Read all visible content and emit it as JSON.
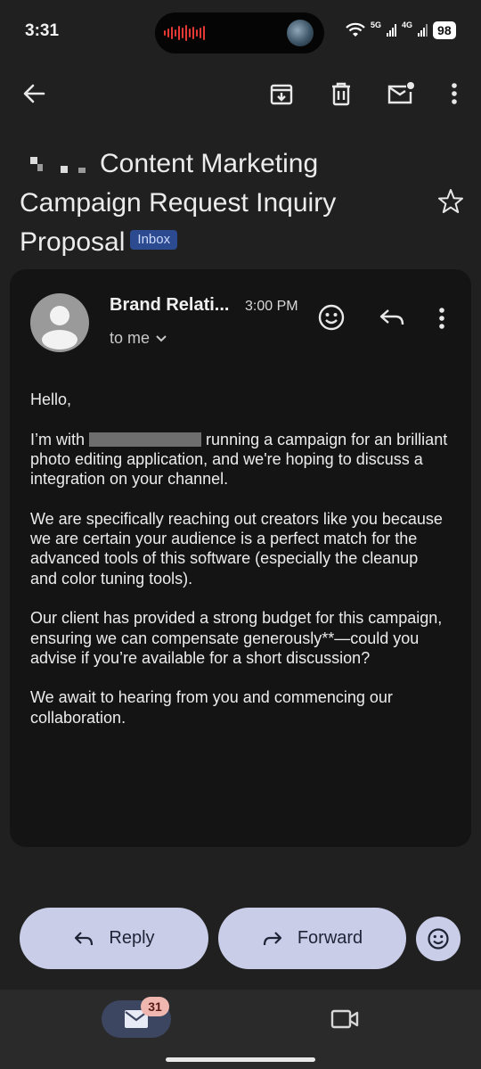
{
  "status_bar": {
    "time": "3:31",
    "net_a": "5G",
    "net_b": "4G",
    "battery": "98"
  },
  "toolbar": {
    "back": "arrow-left-icon",
    "archive": "archive-icon",
    "delete": "trash-icon",
    "mark_unread": "mark-unread-icon",
    "more": "more-vert-icon"
  },
  "subject": {
    "text": "Content Marketing Campaign Request Inquiry Proposal",
    "label": "Inbox"
  },
  "email": {
    "sender": "Brand Relati...",
    "time": "3:00 PM",
    "recipient": "to me",
    "greeting": "Hello,",
    "p1_before": "I’m with",
    "p1_after": "running a campaign for an brilliant photo editing application, and we're hoping to discuss a integration on your channel.",
    "p2": "We are specifically reaching out creators like you because we are certain your audience is a perfect match for the advanced tools of this software (especially the cleanup and color tuning tools).",
    "p3": "Our client has provided a strong budget for this campaign, ensuring we can compensate generously**—could you advise if you’re available for a short discussion?",
    "p4": "We await to hearing from you and commencing our collaboration."
  },
  "actions": {
    "reply": "Reply",
    "forward": "Forward"
  },
  "nav": {
    "mail_badge": "31"
  },
  "colors": {
    "background": "#202020",
    "card": "#141414",
    "pill": "#c9cde8",
    "badge": "#2b4a8f"
  }
}
